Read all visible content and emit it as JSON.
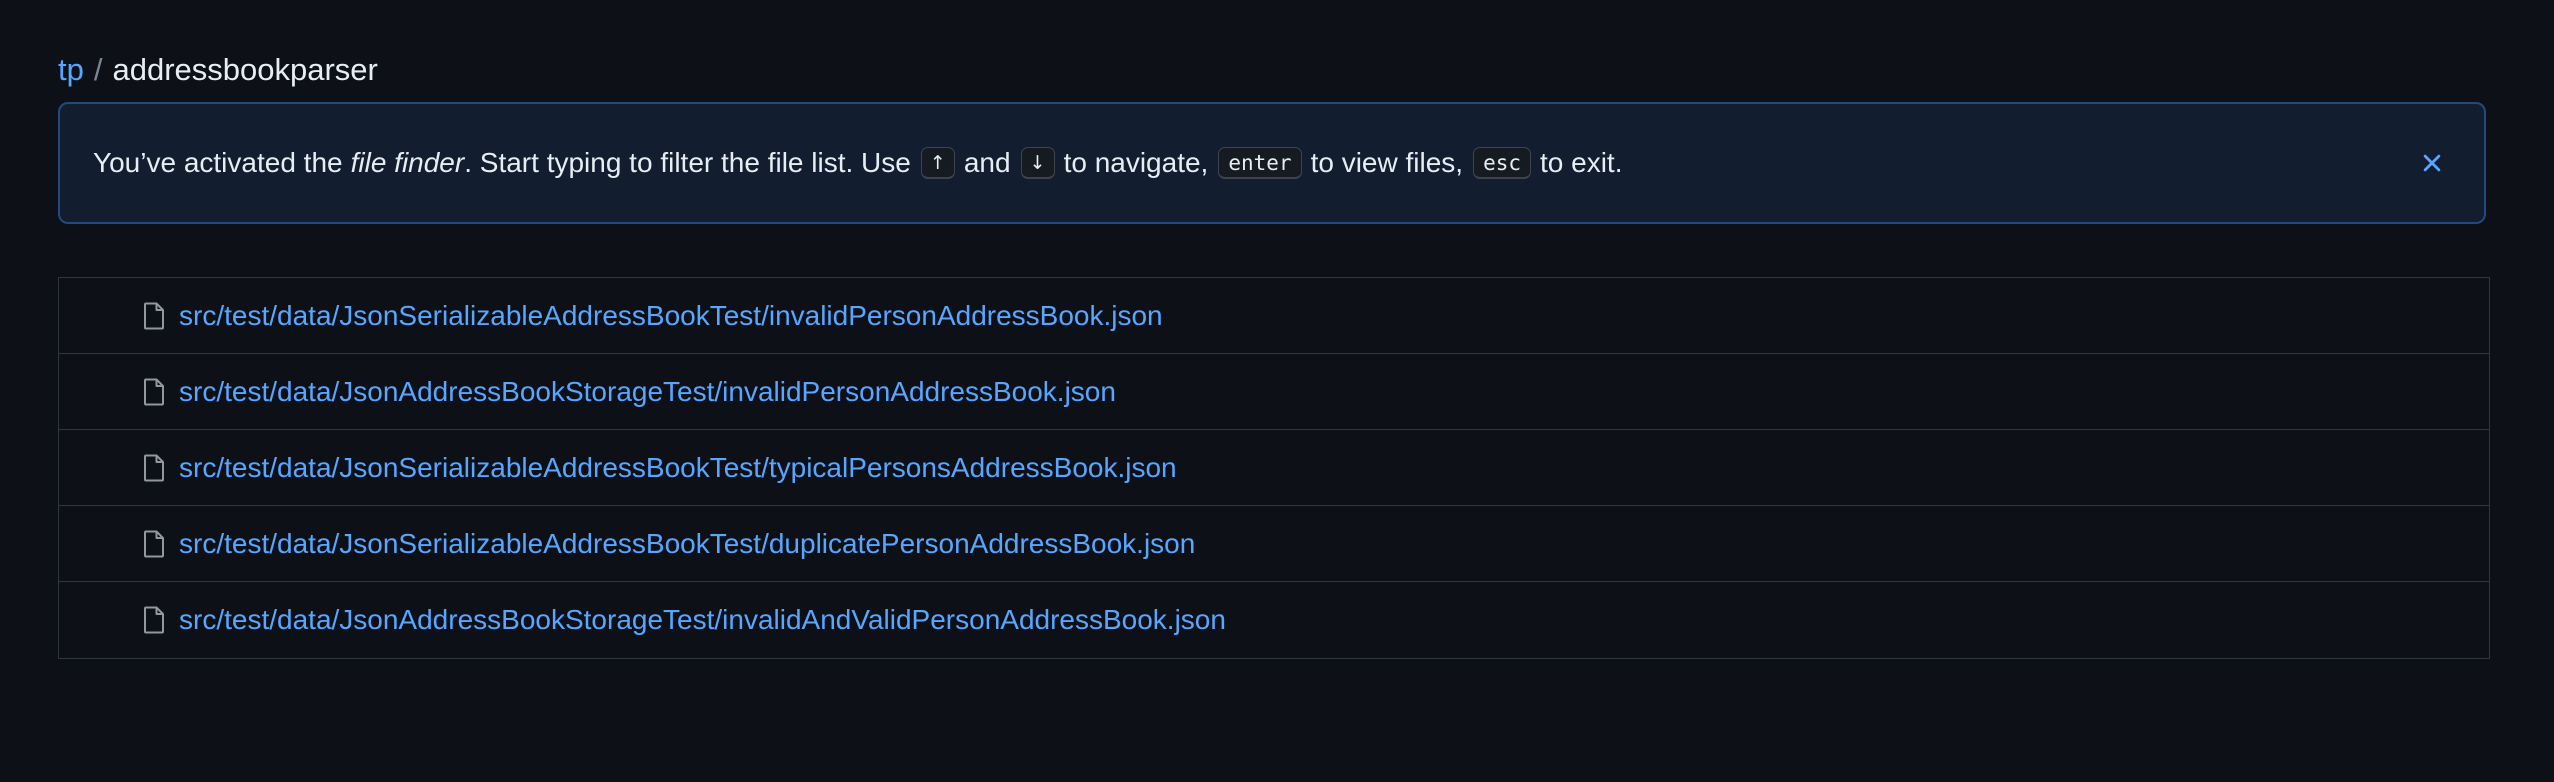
{
  "breadcrumb": {
    "owner": "tp",
    "separator": "/",
    "repo": "addressbookparser"
  },
  "flash": {
    "text_1": "You’ve activated the",
    "text_italic": "file finder",
    "text_2": ". Start typing to filter the file list. Use",
    "key_up": "↑",
    "text_and": "and",
    "key_down": "↓",
    "text_navigate": "to navigate,",
    "key_enter": "enter",
    "text_view": "to view files,",
    "key_esc": "esc",
    "text_exit": "to exit.",
    "close_icon": "close-icon"
  },
  "files": [
    "src/test/data/JsonSerializableAddressBookTest/invalidPersonAddressBook.json",
    "src/test/data/JsonAddressBookStorageTest/invalidPersonAddressBook.json",
    "src/test/data/JsonSerializableAddressBookTest/typicalPersonsAddressBook.json",
    "src/test/data/JsonSerializableAddressBookTest/duplicatePersonAddressBook.json",
    "src/test/data/JsonAddressBookStorageTest/invalidAndValidPersonAddressBook.json"
  ],
  "colors": {
    "background": "#0d1117",
    "link": "#58a6ff",
    "flash_bg": "#121d2f",
    "flash_border": "#1f4a85",
    "border": "#30363d"
  }
}
